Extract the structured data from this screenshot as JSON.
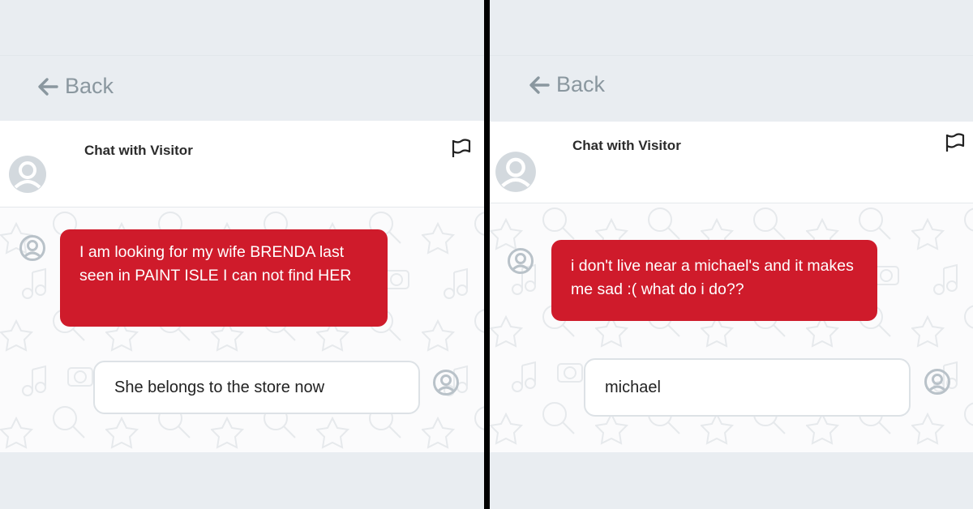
{
  "panels": [
    {
      "back_label": "Back",
      "header_title": "Chat with Visitor",
      "messages": [
        {
          "from": "visitor",
          "text": "I am looking for my wife BRENDA last seen in PAINT ISLE I can not find HER"
        },
        {
          "from": "agent",
          "text": "She belongs to the store now"
        }
      ]
    },
    {
      "back_label": "Back",
      "header_title": "Chat with Visitor",
      "messages": [
        {
          "from": "visitor",
          "text": "i don't live near a michael's and it makes me sad :( what do i do??"
        },
        {
          "from": "agent",
          "text": "michael"
        }
      ]
    }
  ],
  "colors": {
    "visitor_bubble": "#cf1b2b",
    "agent_bubble": "#ffffff",
    "page_bg": "#e9edf1",
    "back_text": "#8a979f"
  }
}
